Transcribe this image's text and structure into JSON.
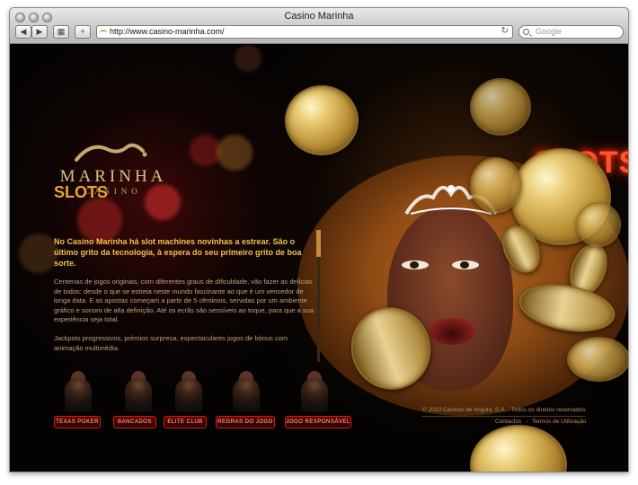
{
  "browser": {
    "window_title": "Casino Marinha",
    "url": "http://www.casino-marinha.com/",
    "search_placeholder": "Google"
  },
  "logo": {
    "word": "MARINHA",
    "sub": "CASINO"
  },
  "main": {
    "heading": "SLOTS",
    "lead": "No Casino Marinha há slot machines novinhas a estrear. São o último grito da tecnologia, à espera do seu primeiro grito de boa sorte.",
    "paragraph1": "Centenas de jogos originais, com diferentes graus de dificuldade, vão fazer as delícias de todos: desde o que se estreia neste mundo fascinante ao que é um vencedor de longa data. E as apostas começam a partir de 5 cêntimos, servidas por um ambiente gráfico e sonoro de alta definição. Até os ecrãs são sensíveis ao toque, para que a sua experiência seja total.",
    "paragraph2": "Jackpots progressivos, prémios surpresa, espectaculares jogos de bónus com animação multimédia."
  },
  "nav_buttons": [
    {
      "label": "TEXAS POKER"
    },
    {
      "label": "BANCADOS"
    },
    {
      "label": "ELITE CLUB"
    },
    {
      "label": "REGRAS DO JOGO"
    },
    {
      "label": "JOGO RESPONSÁVEL"
    }
  ],
  "neon_sign": "SLOTS",
  "footer": {
    "copyright": "© 2010 Casinos de Angola, S.A. - Todos os direitos reservados.",
    "link_contactos": "Contactos",
    "separator": "-",
    "link_termos": "Termos de Utilização"
  },
  "colors": {
    "accent_gold": "#e9a33a",
    "lead_yellow": "#f1c24c",
    "body_text": "#c2a27a",
    "button_red": "#c02020",
    "neon_red": "#ff5233"
  },
  "icons": [
    "back-icon",
    "forward-icon",
    "bookmarks-grid-icon",
    "add-bookmark-icon",
    "reload-icon",
    "search-icon"
  ]
}
